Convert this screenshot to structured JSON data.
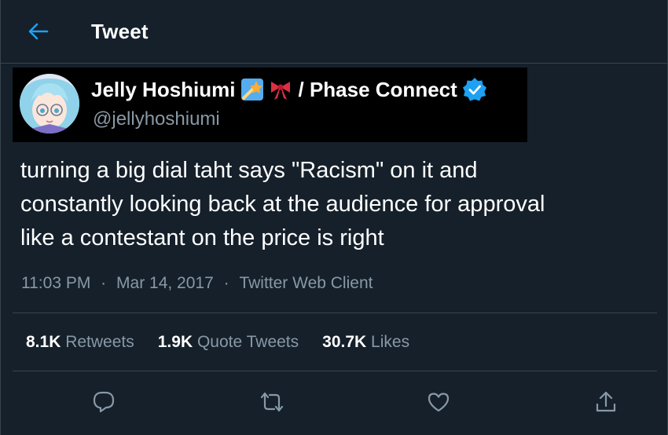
{
  "header": {
    "title": "Tweet",
    "back_icon": "arrow-left-icon"
  },
  "user": {
    "display_name": "Jelly Hoshiumi",
    "emojis": [
      "shooting-star-emoji",
      "ribbon-emoji"
    ],
    "separator": "/ Phase Connect",
    "verified_icon": "verified-badge-icon",
    "handle": "@jellyhoshiumi"
  },
  "tweet": {
    "line1": "turning a big dial taht says \"Racism\" on it and",
    "line2": "constantly looking back at the audience for approval",
    "line3": "like a contestant on the price is right"
  },
  "meta": {
    "time": "11:03 PM",
    "dot1": "·",
    "date": "Mar 14, 2017",
    "dot2": "·",
    "client": "Twitter Web Client"
  },
  "stats": {
    "retweets_count": "8.1K",
    "retweets_label": "Retweets",
    "quotes_count": "1.9K",
    "quotes_label": "Quote Tweets",
    "likes_count": "30.7K",
    "likes_label": "Likes"
  },
  "actions": [
    "reply-icon",
    "retweet-icon",
    "like-icon",
    "share-icon"
  ],
  "colors": {
    "background": "#15202b",
    "accent": "#1da1f2",
    "secondary_text": "#8899a6",
    "border": "#38444d"
  }
}
